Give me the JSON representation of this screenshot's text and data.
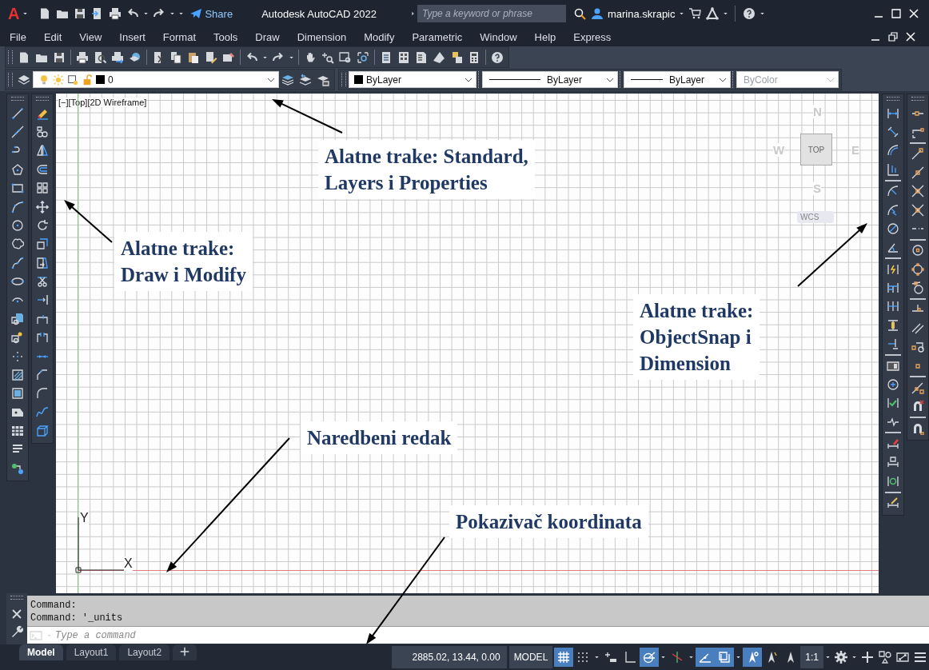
{
  "title_bar": {
    "logo": "A",
    "share": "Share",
    "title": "Autodesk AutoCAD 2022",
    "search_placeholder": "Type a keyword or phrase",
    "user": "marina.skrapic"
  },
  "menu": [
    "File",
    "Edit",
    "View",
    "Insert",
    "Format",
    "Tools",
    "Draw",
    "Dimension",
    "Modify",
    "Parametric",
    "Window",
    "Help",
    "Express"
  ],
  "layers_toolbar": {
    "layer": "0",
    "color_setting": "ByLayer",
    "linetype": "ByLayer",
    "lineweight": "ByLayer",
    "plot_style": {
      "value": "ByColor",
      "disabled": true
    }
  },
  "viewport": {
    "label": "[−][Top][2D Wireframe]",
    "viewcube": {
      "north": "N",
      "west": "W",
      "east": "E",
      "south": "S",
      "face": "TOP",
      "ucs": "WCS"
    },
    "ucs_icon": {
      "x": "X",
      "y": "Y"
    }
  },
  "annotations": [
    {
      "lines": [
        "Alatne trake: Standard,",
        "Layers i Properties"
      ]
    },
    {
      "lines": [
        "Alatne trake:",
        "Draw i Modify"
      ]
    },
    {
      "lines": [
        "Alatne trake:",
        "ObjectSnap  i",
        "Dimension"
      ]
    },
    {
      "lines": [
        "Naredbeni redak"
      ]
    },
    {
      "lines": [
        "Pokazivač koordinata"
      ]
    }
  ],
  "command_line": {
    "history": [
      "Command:",
      "Command: '_units"
    ],
    "placeholder": "Type a command"
  },
  "layout_tabs": [
    {
      "label": "Model",
      "selected": true
    },
    {
      "label": "Layout1",
      "selected": false
    },
    {
      "label": "Layout2",
      "selected": false
    }
  ],
  "status_bar": {
    "coordinates": "2885.02, 13.44, 0.00",
    "space": "MODEL",
    "toggles": [
      {
        "kind": "grid",
        "on": true
      },
      {
        "kind": "snap",
        "on": false
      },
      {
        "kind": "infer",
        "on": false
      },
      {
        "kind": "ortho",
        "on": false
      },
      {
        "kind": "polar",
        "on": true
      },
      {
        "kind": "isodraft",
        "on": false
      },
      {
        "kind": "otrack",
        "on": true
      },
      {
        "kind": "osnap",
        "on": true
      },
      {
        "kind": "annovis",
        "on": true
      },
      {
        "kind": "autoscale",
        "on": false
      },
      {
        "kind": "annoscale",
        "on": false
      }
    ],
    "scale": "1:1"
  }
}
